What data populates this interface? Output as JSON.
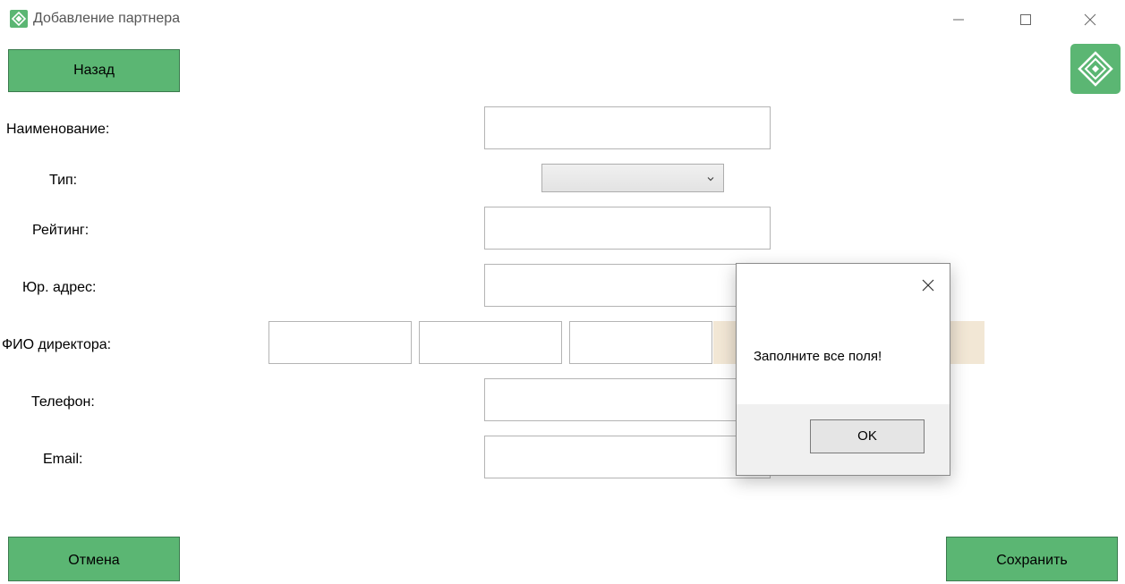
{
  "window": {
    "title": "Добавление партнера",
    "icon": "app-logo-icon",
    "controls": [
      "minimize-icon",
      "maximize-icon",
      "close-icon"
    ]
  },
  "colors": {
    "accent": "#5bb673",
    "accent_border": "#3b7a4e",
    "highlight": "#f2e7d5"
  },
  "toolbar": {
    "back_label": "Назад"
  },
  "form": {
    "name_label": "Наименование:",
    "type_label": "Тип:",
    "rating_label": "Рейтинг:",
    "address_label": "Юр. адрес:",
    "director_label": "ФИО директора:",
    "phone_label": "Телефон:",
    "email_label": "Email:",
    "type_selected": ""
  },
  "footer": {
    "cancel_label": "Отмена",
    "save_label": "Сохранить"
  },
  "dialog": {
    "message": "Заполните все поля!",
    "ok_label": "OK"
  }
}
